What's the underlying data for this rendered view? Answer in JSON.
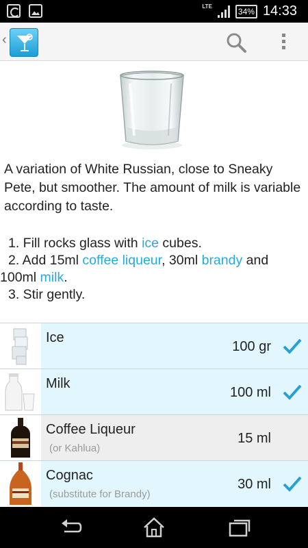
{
  "status_bar": {
    "icons": [
      "sync-icon",
      "gallery-icon",
      "lte-signal-icon",
      "battery-icon"
    ],
    "network": "LTE",
    "battery": "34%",
    "time": "14:33"
  },
  "action_bar": {
    "back_glyph": "‹",
    "icons": [
      "cocktail-app-icon",
      "search-icon",
      "overflow-menu-icon"
    ]
  },
  "recipe": {
    "description": "A variation of White Russian, close to Sneaky Pete, but smoother. The amount of milk is variable according to taste.",
    "steps": [
      {
        "prefix": "1. Fill rocks glass with ",
        "link": "ice",
        "suffix": " cubes."
      },
      {
        "prefix": "2. Add 15ml ",
        "link": "coffee liqueur",
        "middle": ", 30ml ",
        "link2": "brandy",
        "suffix": " and"
      },
      {
        "prefix": "100ml ",
        "link": "milk",
        "suffix": "."
      },
      {
        "prefix": "3. Stir gently.",
        "link": "",
        "suffix": ""
      }
    ]
  },
  "ingredients": [
    {
      "name": "Ice",
      "note": "",
      "amount": "100 gr",
      "available": true
    },
    {
      "name": "Milk",
      "note": "",
      "amount": "100 ml",
      "available": true
    },
    {
      "name": "Coffee Liqueur",
      "note": "(or Kahlua)",
      "amount": "15 ml",
      "available": false
    },
    {
      "name": "Cognac",
      "note": "(substitute for Brandy)",
      "amount": "30 ml",
      "available": true
    }
  ],
  "colors": {
    "accent": "#29a9d8",
    "available_row": "#e2f7fd",
    "unavailable_row": "#eeeeee"
  },
  "nav_bar": {
    "icons": [
      "back-icon",
      "home-icon",
      "recent-apps-icon"
    ]
  }
}
